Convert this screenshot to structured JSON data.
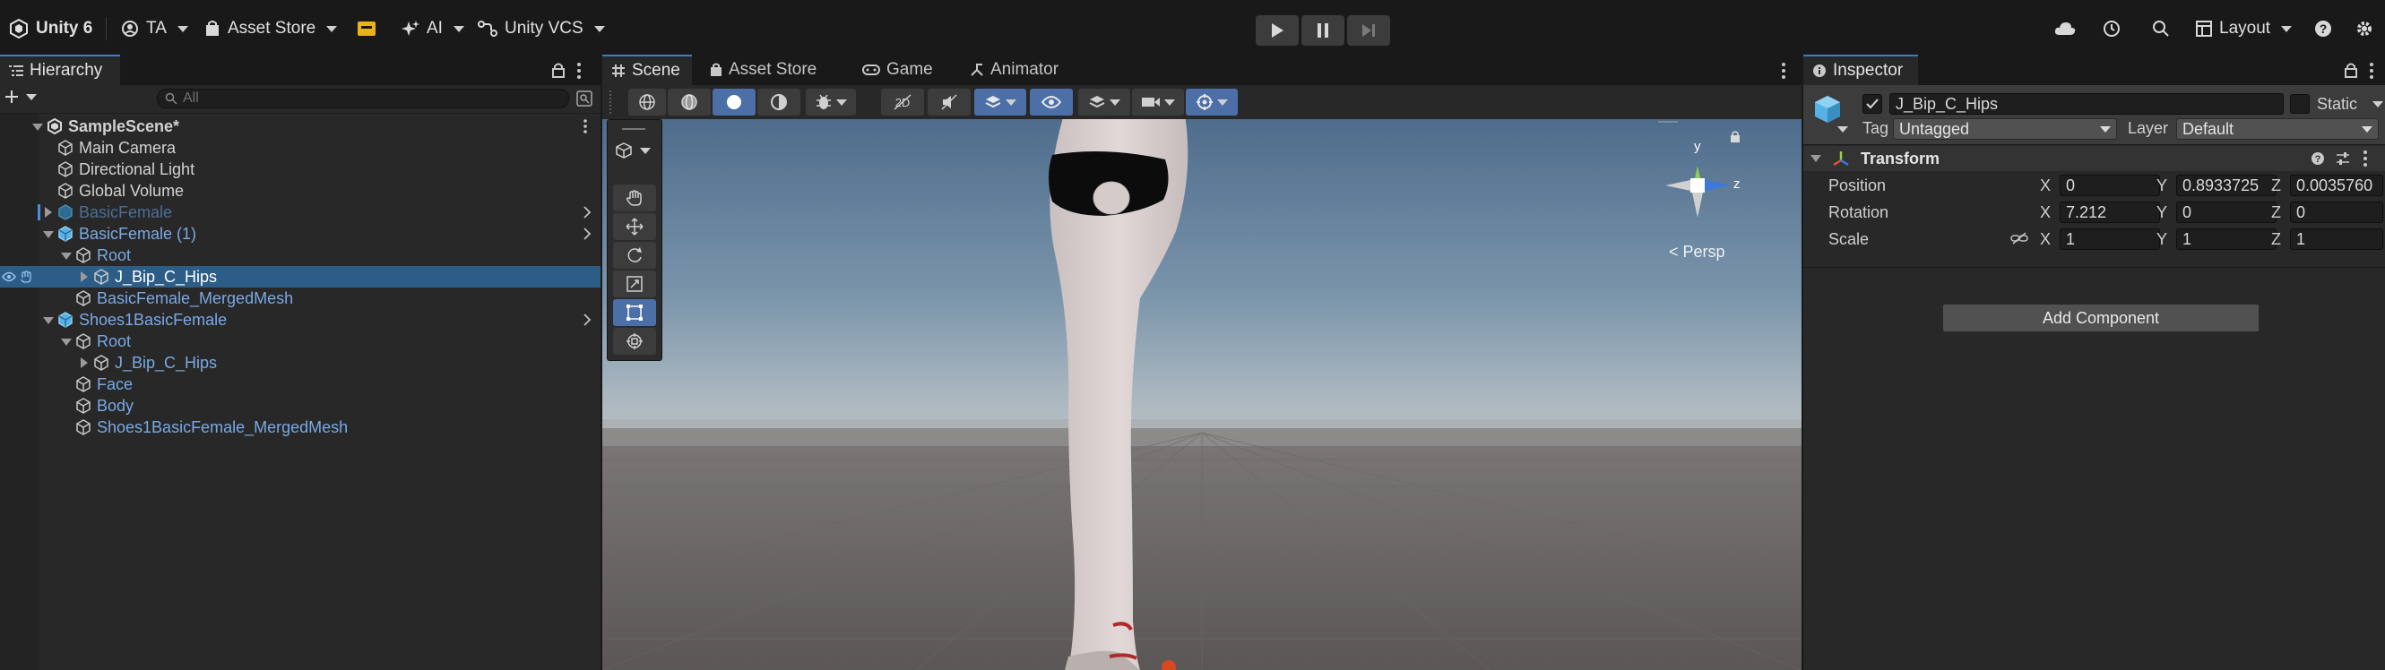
{
  "topbar": {
    "app_label": "Unity 6",
    "account_label": "TA",
    "asset_store_label": "Asset Store",
    "ai_label": "AI",
    "vcs_label": "Unity VCS",
    "layout_label": "Layout"
  },
  "hierarchy": {
    "tab_label": "Hierarchy",
    "search_placeholder": "All",
    "items": [
      {
        "label": "SampleScene*",
        "depth": 0,
        "expanded": true
      },
      {
        "label": "Main Camera",
        "depth": 1
      },
      {
        "label": "Directional Light",
        "depth": 1
      },
      {
        "label": "Global Volume",
        "depth": 1
      },
      {
        "label": "BasicFemale",
        "depth": 1,
        "style": "inactive-prefab"
      },
      {
        "label": "BasicFemale (1)",
        "depth": 1,
        "style": "prefab",
        "expanded": true
      },
      {
        "label": "Root",
        "depth": 2,
        "style": "prefab-child",
        "expanded": true
      },
      {
        "label": "J_Bip_C_Hips",
        "depth": 3,
        "selected": true
      },
      {
        "label": "BasicFemale_MergedMesh",
        "depth": 2,
        "style": "prefab-child"
      },
      {
        "label": "Shoes1BasicFemale",
        "depth": 1,
        "style": "prefab",
        "expanded": true
      },
      {
        "label": "Root",
        "depth": 2,
        "style": "prefab-child",
        "expanded": true
      },
      {
        "label": "J_Bip_C_Hips",
        "depth": 3,
        "style": "prefab-child"
      },
      {
        "label": "Face",
        "depth": 2,
        "style": "prefab-child"
      },
      {
        "label": "Body",
        "depth": 2,
        "style": "prefab-child"
      },
      {
        "label": "Shoes1BasicFemale_MergedMesh",
        "depth": 2,
        "style": "prefab-child"
      }
    ]
  },
  "scene": {
    "tabs": [
      "Scene",
      "Asset Store",
      "Game",
      "Animator"
    ],
    "active_tab": "Scene",
    "gizmo_y": "y",
    "gizmo_z": "z",
    "projection_label": "< Persp"
  },
  "inspector": {
    "tab_label": "Inspector",
    "object_name": "J_Bip_C_Hips",
    "static_label": "Static",
    "tag_label": "Tag",
    "tag_value": "Untagged",
    "layer_label": "Layer",
    "layer_value": "Default",
    "transform": {
      "title": "Transform",
      "position_label": "Position",
      "rotation_label": "Rotation",
      "scale_label": "Scale",
      "axis_x": "X",
      "axis_y": "Y",
      "axis_z": "Z",
      "position": {
        "x": "0",
        "y": "0.8933725",
        "z": "0.0035760"
      },
      "rotation": {
        "x": "7.212",
        "y": "0",
        "z": "0"
      },
      "scale": {
        "x": "1",
        "y": "1",
        "z": "1"
      }
    },
    "add_component_label": "Add Component"
  },
  "colors": {
    "selection": "#2c5d87",
    "prefab_text": "#79a9e6",
    "accent": "#3a7bd5"
  }
}
